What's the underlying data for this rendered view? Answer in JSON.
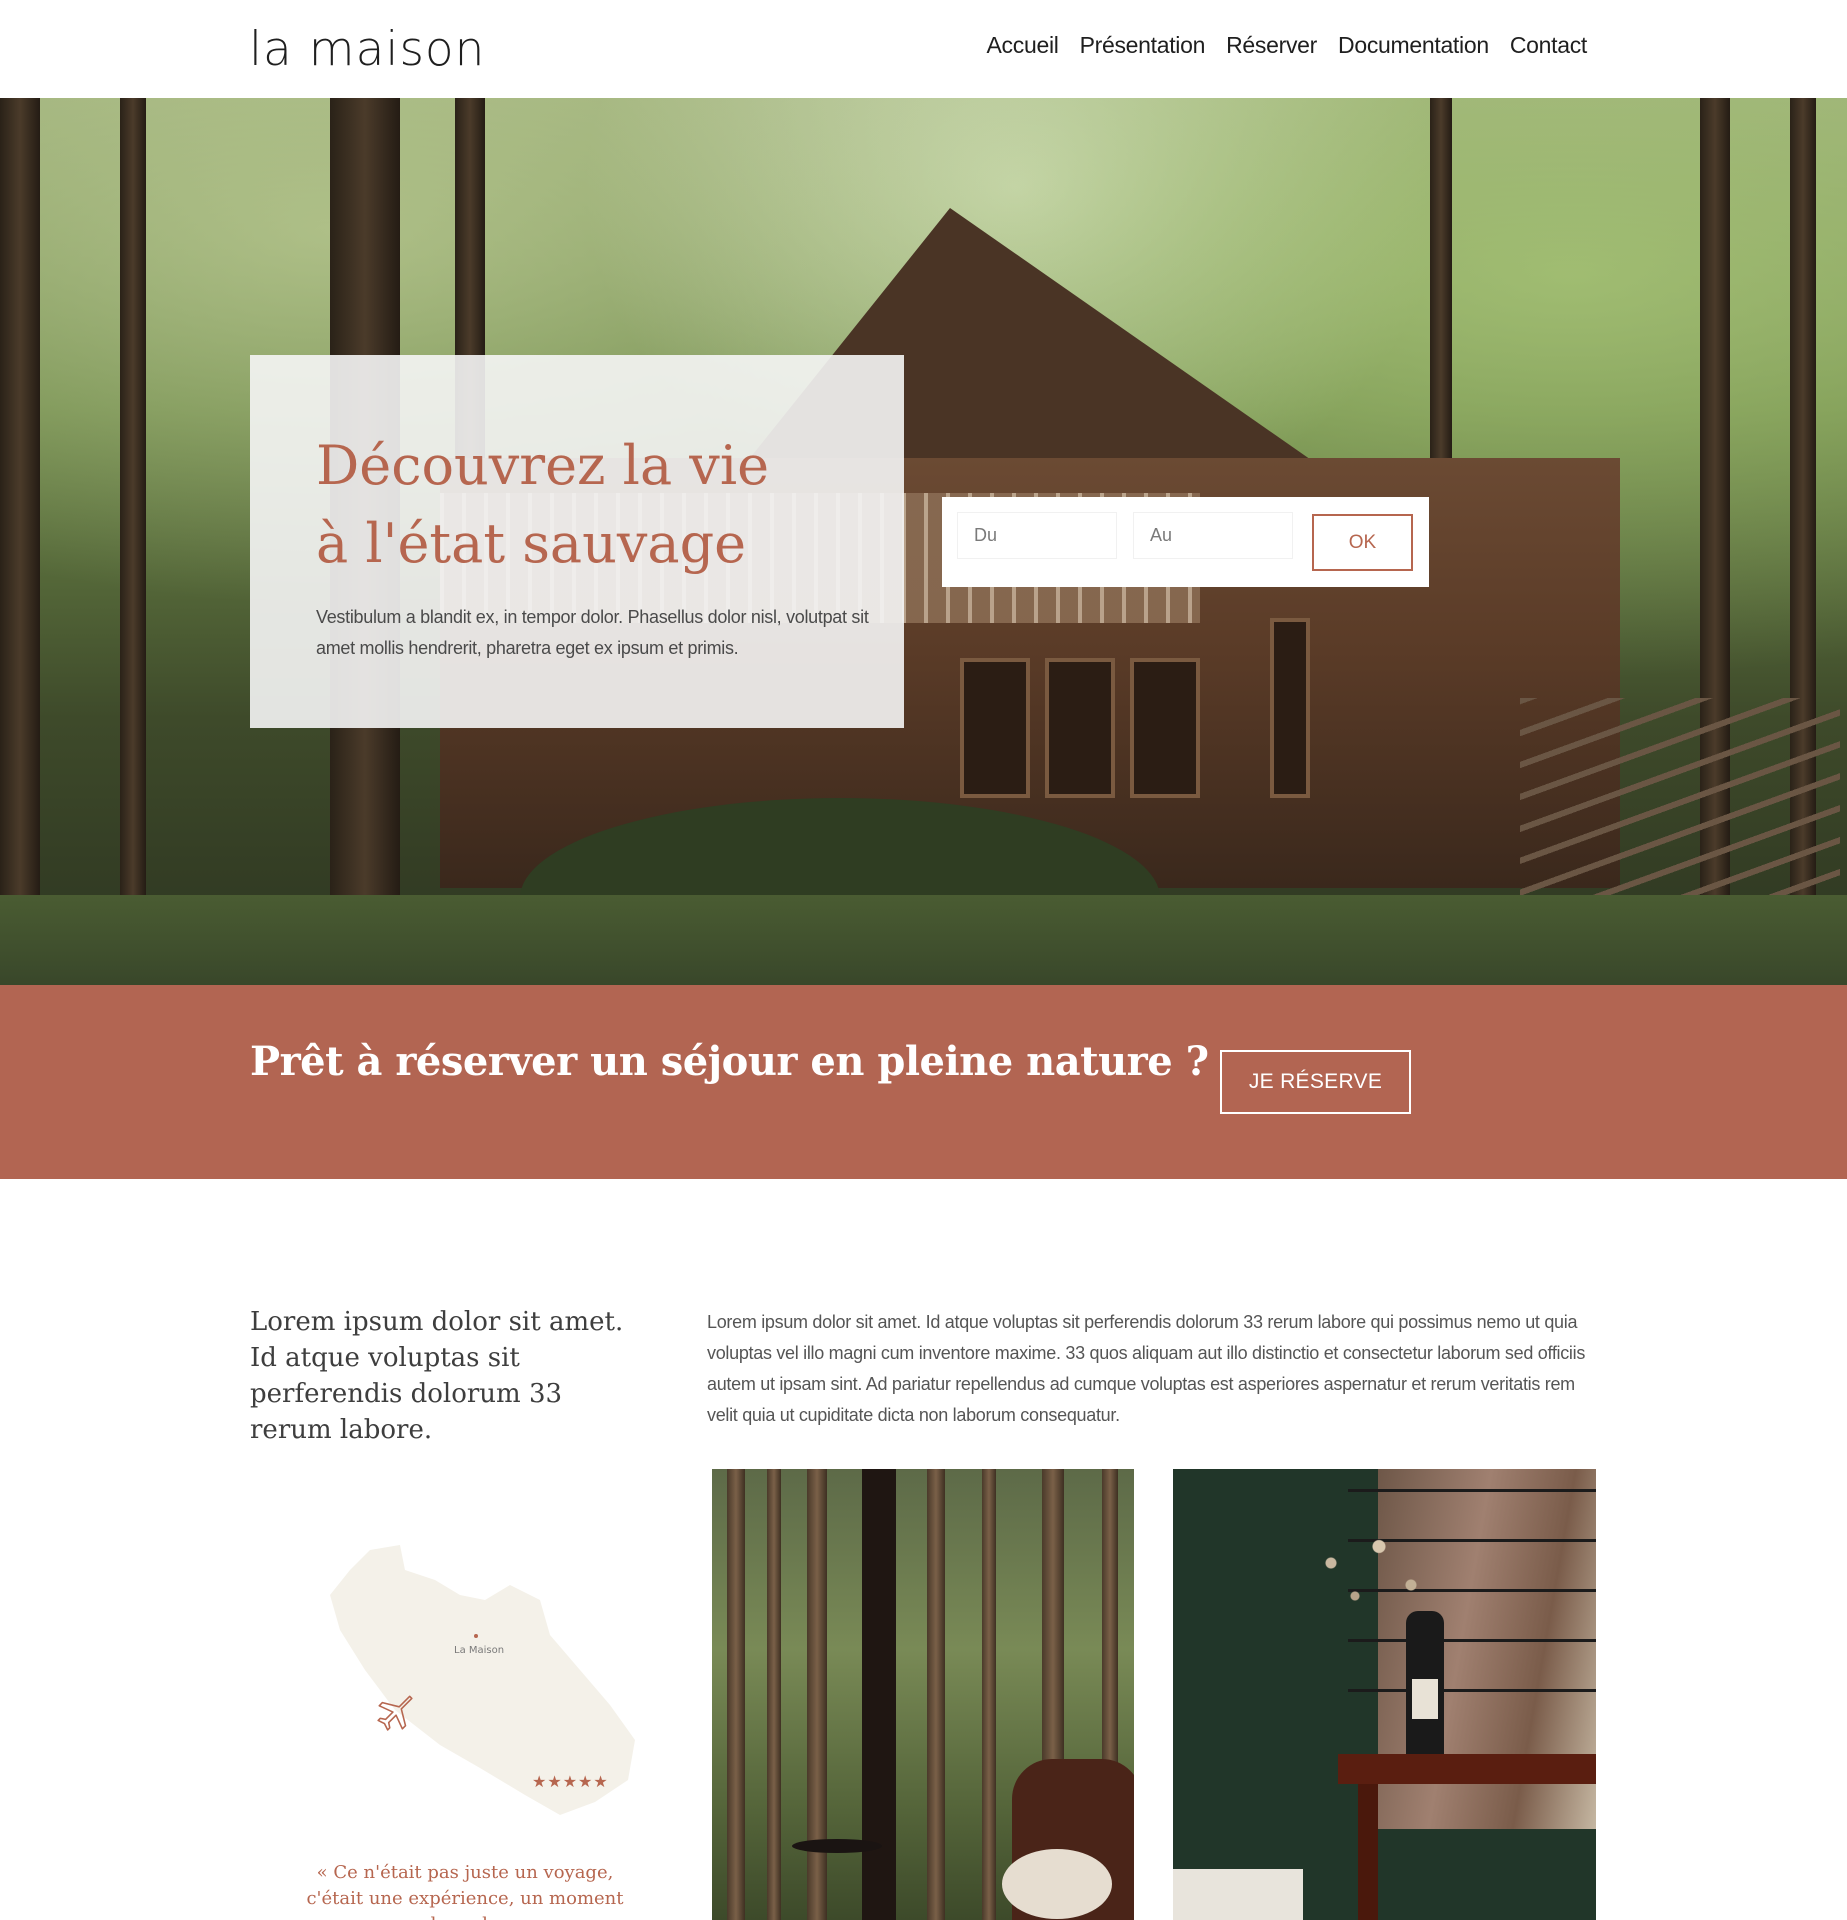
{
  "header": {
    "logo": "la maison",
    "nav": [
      "Accueil",
      "Présentation",
      "Réserver",
      "Documentation",
      "Contact"
    ]
  },
  "hero": {
    "title_line1": "Découvrez la vie",
    "title_line2": "à l'état sauvage",
    "text": "Vestibulum a blandit ex, in tempor dolor. Phasellus dolor nisl, volutpat sit amet mollis hendrerit, pharetra eget ex ipsum et primis."
  },
  "booking": {
    "from_placeholder": "Du",
    "to_placeholder": "Au",
    "ok_label": "OK"
  },
  "cta": {
    "text": "Prêt à réserver un séjour en pleine nature ?",
    "button_label": "JE RÉSERVE"
  },
  "intro": {
    "lead": "Lorem ipsum dolor sit amet. Id atque voluptas sit perferendis dolorum 33 rerum labore.",
    "body": "Lorem ipsum dolor sit amet. Id atque voluptas sit perferendis dolorum 33 rerum labore qui possimus nemo ut quia voluptas vel illo magni cum inventore maxime. 33 quos aliquam aut illo distinctio et consectetur laborum sed officiis autem ut ipsam sint. Ad pariatur repellendus ad cumque voluptas est asperiores aspernatur et rerum veritatis rem velit quia ut cupiditate dicta non laborum consequatur."
  },
  "map": {
    "label": "La Maison",
    "stars": "★★★★★"
  },
  "quote": {
    "text": "« Ce n'était pas juste un voyage, c'était une expérience, un moment hors du"
  },
  "colors": {
    "accent": "#b6664f",
    "cta_band": "#b26552",
    "text": "#3a3a3a"
  }
}
